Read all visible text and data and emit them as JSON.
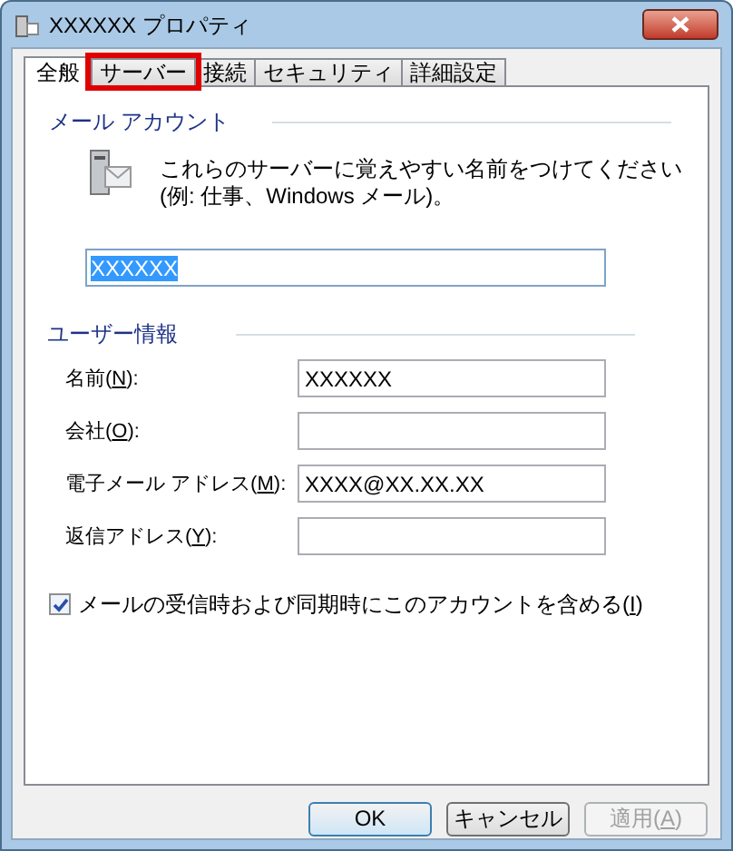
{
  "window": {
    "title": "XXXXXX プロパティ"
  },
  "tabs": [
    {
      "label": "全般",
      "selected": true,
      "highlighted": false
    },
    {
      "label": "サーバー",
      "selected": false,
      "highlighted": true
    },
    {
      "label": "接続",
      "selected": false,
      "highlighted": false
    },
    {
      "label": "セキュリティ",
      "selected": false,
      "highlighted": false
    },
    {
      "label": "詳細設定",
      "selected": false,
      "highlighted": false
    }
  ],
  "mail_account": {
    "heading": "メール アカウント",
    "description": [
      "これらのサーバーに覚えやすい名前をつけてください",
      "(例: 仕事、Windows メール)。"
    ],
    "name_field": {
      "value": "XXXXXX",
      "text_selected": true
    }
  },
  "user_info": {
    "heading": "ユーザー情報",
    "fields": [
      {
        "label_before": "名前(",
        "access_key": "N",
        "label_after": "):",
        "value": "XXXXXX"
      },
      {
        "label_before": "会社(",
        "access_key": "O",
        "label_after": "):"
      },
      {
        "label_before": "電子メール アドレス(",
        "access_key": "M",
        "label_after": "):",
        "value": "XXXX@XX.XX.XX"
      },
      {
        "label_before": "返信アドレス(",
        "access_key": "Y",
        "label_after": "):"
      }
    ]
  },
  "include_checkbox": {
    "label_before": "メールの受信時および同期時にこのアカウントを含める(",
    "access_key": "I",
    "label_after": ")",
    "checked": true
  },
  "buttons": [
    {
      "label": "OK",
      "disabled": false,
      "default": true
    },
    {
      "label": "キャンセル",
      "disabled": false,
      "default": false
    },
    {
      "label_before": "適用(",
      "access_key": "A",
      "label_after": ")",
      "disabled": true,
      "default": false
    }
  ]
}
